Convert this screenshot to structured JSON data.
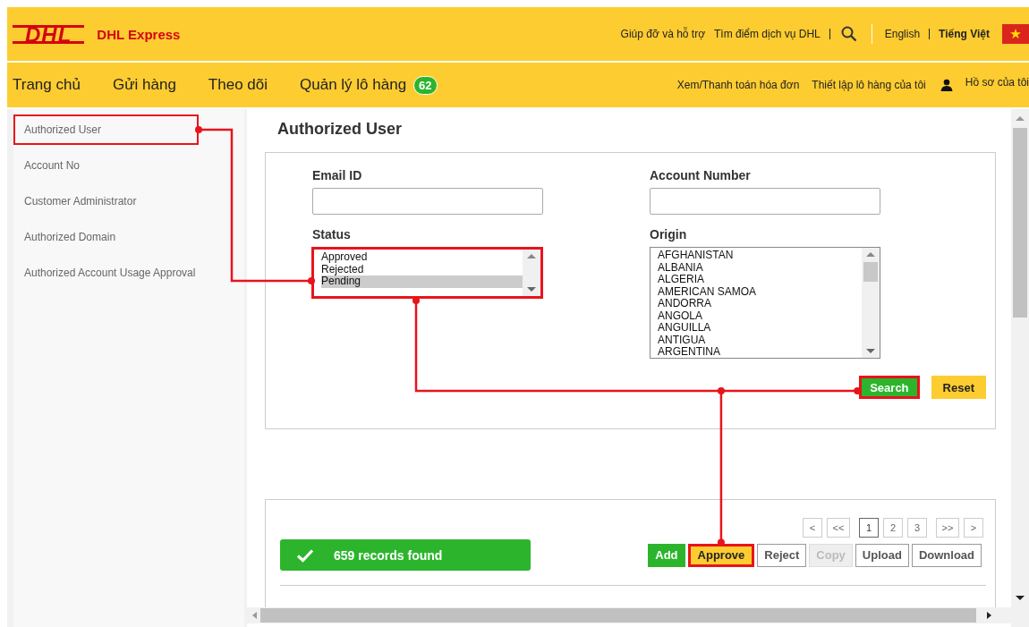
{
  "brand": {
    "logo": "DHL",
    "name": "DHL Express"
  },
  "top_links": [
    "Giúp đỡ và hỗ trợ",
    "Tìm điểm dịch vụ DHL"
  ],
  "languages": [
    {
      "label": "English",
      "selected": false
    },
    {
      "label": "Tiếng Việt",
      "selected": true
    }
  ],
  "nav": [
    {
      "label": "Trang chủ"
    },
    {
      "label": "Gửi hàng"
    },
    {
      "label": "Theo dõi"
    },
    {
      "label": "Quản lý lô hàng",
      "badge": "62"
    }
  ],
  "nav_right": [
    "Xem/Thanh toán hóa đơn",
    "Thiết lập lô hàng của tôi"
  ],
  "profile": "Hồ sơ của tôi",
  "sidebar": {
    "items": [
      {
        "label": "Authorized User",
        "highlighted": true
      },
      {
        "label": "Account No",
        "highlighted": false
      },
      {
        "label": "Customer Administrator",
        "highlighted": false
      },
      {
        "label": "Authorized Domain",
        "highlighted": false
      },
      {
        "label": "Authorized Account Usage Approval",
        "highlighted": false
      }
    ]
  },
  "page_title": "Authorized User",
  "form": {
    "email_label": "Email ID",
    "account_label": "Account Number",
    "status": {
      "label": "Status",
      "highlighted": true,
      "options": [
        {
          "label": "Approved",
          "selected": false
        },
        {
          "label": "Rejected",
          "selected": false
        },
        {
          "label": "Pending",
          "selected": true
        }
      ]
    },
    "origin": {
      "label": "Origin",
      "options": [
        "AFGHANISTAN",
        "ALBANIA",
        "ALGERIA",
        "AMERICAN SAMOA",
        "ANDORRA",
        "ANGOLA",
        "ANGUILLA",
        "ANTIGUA",
        "ARGENTINA"
      ]
    },
    "buttons": [
      {
        "label": "Search",
        "kind": "green",
        "highlighted": true
      },
      {
        "label": "Reset",
        "kind": "yellow",
        "highlighted": false
      }
    ]
  },
  "results": {
    "message": "659 records found",
    "pagination": [
      {
        "label": "<",
        "selected": false
      },
      {
        "label": "<<",
        "selected": false
      },
      {
        "label": "1",
        "selected": true
      },
      {
        "label": "2",
        "selected": false
      },
      {
        "label": "3",
        "selected": false
      },
      {
        "label": ">>",
        "selected": false
      },
      {
        "label": ">",
        "selected": false
      }
    ],
    "actions": [
      {
        "label": "Add",
        "kind": "green",
        "highlighted": false,
        "disabled": false
      },
      {
        "label": "Approve",
        "kind": "yellow",
        "highlighted": true,
        "disabled": false
      },
      {
        "label": "Reject",
        "kind": "plain",
        "highlighted": false,
        "disabled": false
      },
      {
        "label": "Copy",
        "kind": "plain",
        "highlighted": false,
        "disabled": true
      },
      {
        "label": "Upload",
        "kind": "plain",
        "highlighted": false,
        "disabled": false
      },
      {
        "label": "Download",
        "kind": "plain",
        "highlighted": false,
        "disabled": false
      }
    ]
  }
}
